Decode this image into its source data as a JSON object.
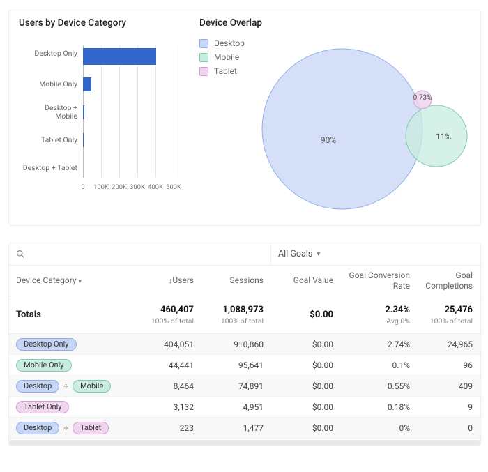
{
  "chart_data": [
    {
      "type": "bar",
      "orientation": "horizontal",
      "title": "Users by Device Category",
      "xlabel": "",
      "ylabel": "",
      "xlim": [
        0,
        500000
      ],
      "xticks": [
        0,
        100000,
        200000,
        300000,
        400000,
        500000
      ],
      "xtick_labels": [
        "0",
        "100K",
        "200K",
        "300K",
        "400K",
        "500K"
      ],
      "categories": [
        "Desktop Only",
        "Mobile Only",
        "Desktop + Mobile",
        "Tablet Only",
        "Desktop + Tablet"
      ],
      "values": [
        404051,
        44441,
        8464,
        3132,
        223
      ],
      "color": "#3366cc"
    },
    {
      "type": "venn",
      "title": "Device Overlap",
      "legend": [
        "Desktop",
        "Mobile",
        "Tablet"
      ],
      "colors": {
        "Desktop": "#b9caef",
        "Mobile": "#a4dccb",
        "Tablet": "#e7bee6"
      },
      "circle_percentages": {
        "Desktop": 90,
        "Mobile": 11,
        "Tablet": 0.73
      },
      "labels_shown": [
        "90%",
        "11%",
        "0.73%"
      ]
    }
  ],
  "bar_title": "Users by Device Category",
  "venn_title": "Device Overlap",
  "legend": {
    "desktop": "Desktop",
    "mobile": "Mobile",
    "tablet": "Tablet"
  },
  "venn_labels": {
    "desktop_pct": "90%",
    "mobile_pct": "11%",
    "tablet_pct": "0.73%"
  },
  "ticks": {
    "t0": "0",
    "t1": "100K",
    "t2": "200K",
    "t3": "300K",
    "t4": "400K",
    "t5": "500K"
  },
  "bar_cats": {
    "c0": "Desktop Only",
    "c1": "Mobile Only",
    "c2": "Desktop +\nMobile",
    "c3": "Tablet Only",
    "c4": "Desktop + Tablet"
  },
  "colors": {
    "desktop_fill": "#c7d6f5",
    "desktop_stroke": "#8faee8",
    "mobile_fill": "#c8ece0",
    "mobile_stroke": "#7ecbb0",
    "tablet_fill": "#f0d5ef",
    "tablet_stroke": "#d49dd1"
  },
  "table": {
    "goals_filter": "All Goals",
    "columns": {
      "device": "Device Category",
      "users": "Users",
      "sessions": "Sessions",
      "goal_value": "Goal Value",
      "goal_cr": "Goal Conversion Rate",
      "goal_comp": "Goal Completions"
    },
    "sort_arrow": "↓",
    "totals": {
      "label": "Totals",
      "users": "460,407",
      "users_sub": "100% of total",
      "sessions": "1,088,973",
      "sessions_sub": "100% of total",
      "goal_value": "$0.00",
      "goal_cr": "2.34%",
      "goal_cr_sub": "Avg 0%",
      "goal_comp": "25,476",
      "goal_comp_sub": "100% of total"
    },
    "rows": [
      {
        "chips": [
          {
            "text": "Desktop Only",
            "c": "desktop"
          }
        ],
        "users": "404,051",
        "sessions": "910,860",
        "gv": "$0.00",
        "gcr": "2.74%",
        "gc": "24,965"
      },
      {
        "chips": [
          {
            "text": "Mobile Only",
            "c": "mobile"
          }
        ],
        "users": "44,441",
        "sessions": "95,641",
        "gv": "$0.00",
        "gcr": "0.1%",
        "gc": "96"
      },
      {
        "chips": [
          {
            "text": "Desktop",
            "c": "desktop"
          },
          {
            "text": "Mobile",
            "c": "mobile"
          }
        ],
        "users": "8,464",
        "sessions": "74,891",
        "gv": "$0.00",
        "gcr": "0.55%",
        "gc": "409"
      },
      {
        "chips": [
          {
            "text": "Tablet Only",
            "c": "tablet"
          }
        ],
        "users": "3,132",
        "sessions": "4,951",
        "gv": "$0.00",
        "gcr": "0.18%",
        "gc": "9"
      },
      {
        "chips": [
          {
            "text": "Desktop",
            "c": "desktop"
          },
          {
            "text": "Tablet",
            "c": "tablet"
          }
        ],
        "users": "223",
        "sessions": "1,477",
        "gv": "$0.00",
        "gcr": "0%",
        "gc": "0"
      }
    ]
  }
}
